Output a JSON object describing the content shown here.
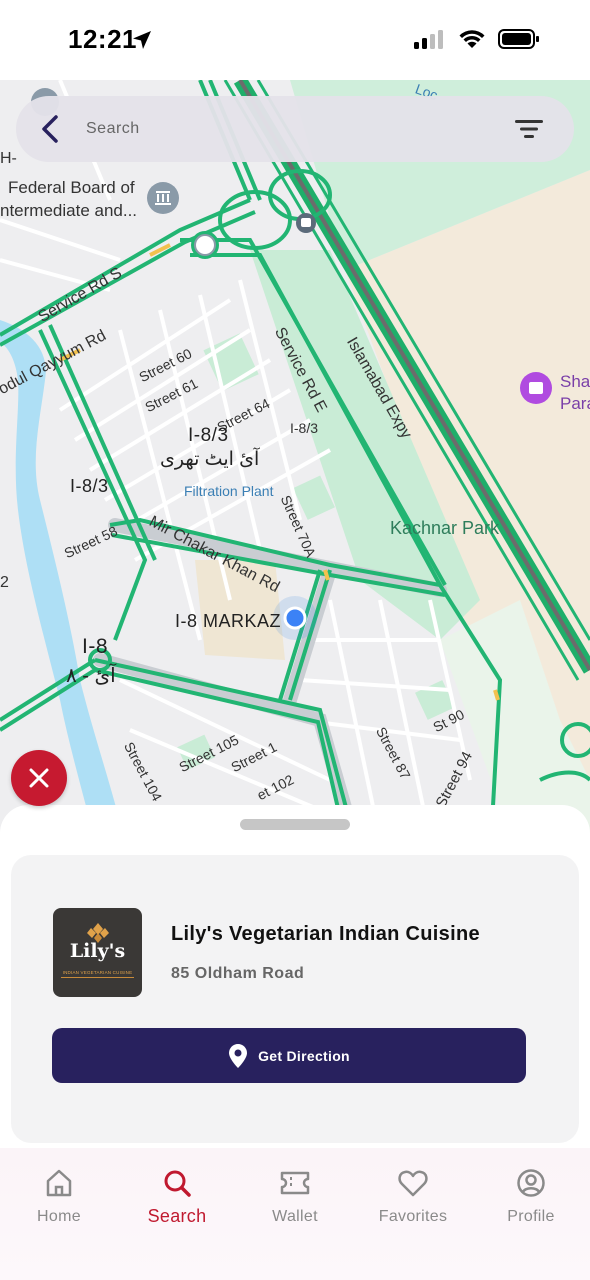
{
  "status": {
    "time": "12:21"
  },
  "search": {
    "placeholder": "Search",
    "value": ""
  },
  "map": {
    "labels": {
      "federal1": "Federal Board of",
      "federal2": "ntermediate and...",
      "service_s": "Service Rd S",
      "qayyum": "odul Qayyum Rd",
      "street60": "Street 60",
      "street61": "Street 61",
      "street64": "Street 64",
      "service_e": "Service Rd E",
      "islamabad": "Islamabad Expy",
      "sha1": "Sha",
      "sha2": "Para",
      "i83_main": "I-8/3",
      "i83_urdu": "آئ ایٹ تھری",
      "i83_small": "I-8/3",
      "i83_left": "I-8/3",
      "filtration": "Filtration Plant",
      "street70a": "Street 70A",
      "kachnar": "Kachnar Park",
      "street58": "Street 58",
      "chakar": "Mir Chakar Khan Rd",
      "markaz": "I-8 MARKAZ",
      "i8": "I-8",
      "i8_urdu": "آئ - ٨",
      "street104": "Street 104",
      "street105": "Street 105",
      "street1": "Street 1",
      "street102": "et 102",
      "street87": "Street 87",
      "st90": "St 90",
      "street94": "Street 94",
      "h": "H-",
      "two": "2",
      "loc": "Loc"
    }
  },
  "place": {
    "name": "Lily's Vegetarian Indian Cuisine",
    "address": "85 Oldham Road",
    "logo_title": "Lily's",
    "logo_subtitle": "INDIAN VEGETARIAN CUISINE",
    "direction_label": "Get Direction"
  },
  "nav": {
    "items": [
      {
        "label": "Home",
        "icon": "home-icon"
      },
      {
        "label": "Search",
        "icon": "search-icon",
        "active": true
      },
      {
        "label": "Wallet",
        "icon": "ticket-icon"
      },
      {
        "label": "Favorites",
        "icon": "heart-icon"
      },
      {
        "label": "Profile",
        "icon": "user-circle-icon"
      }
    ]
  },
  "colors": {
    "accent": "#c0192f",
    "button": "#28215e",
    "road_green": "#1fae6a",
    "park": "#c9ecd6"
  }
}
